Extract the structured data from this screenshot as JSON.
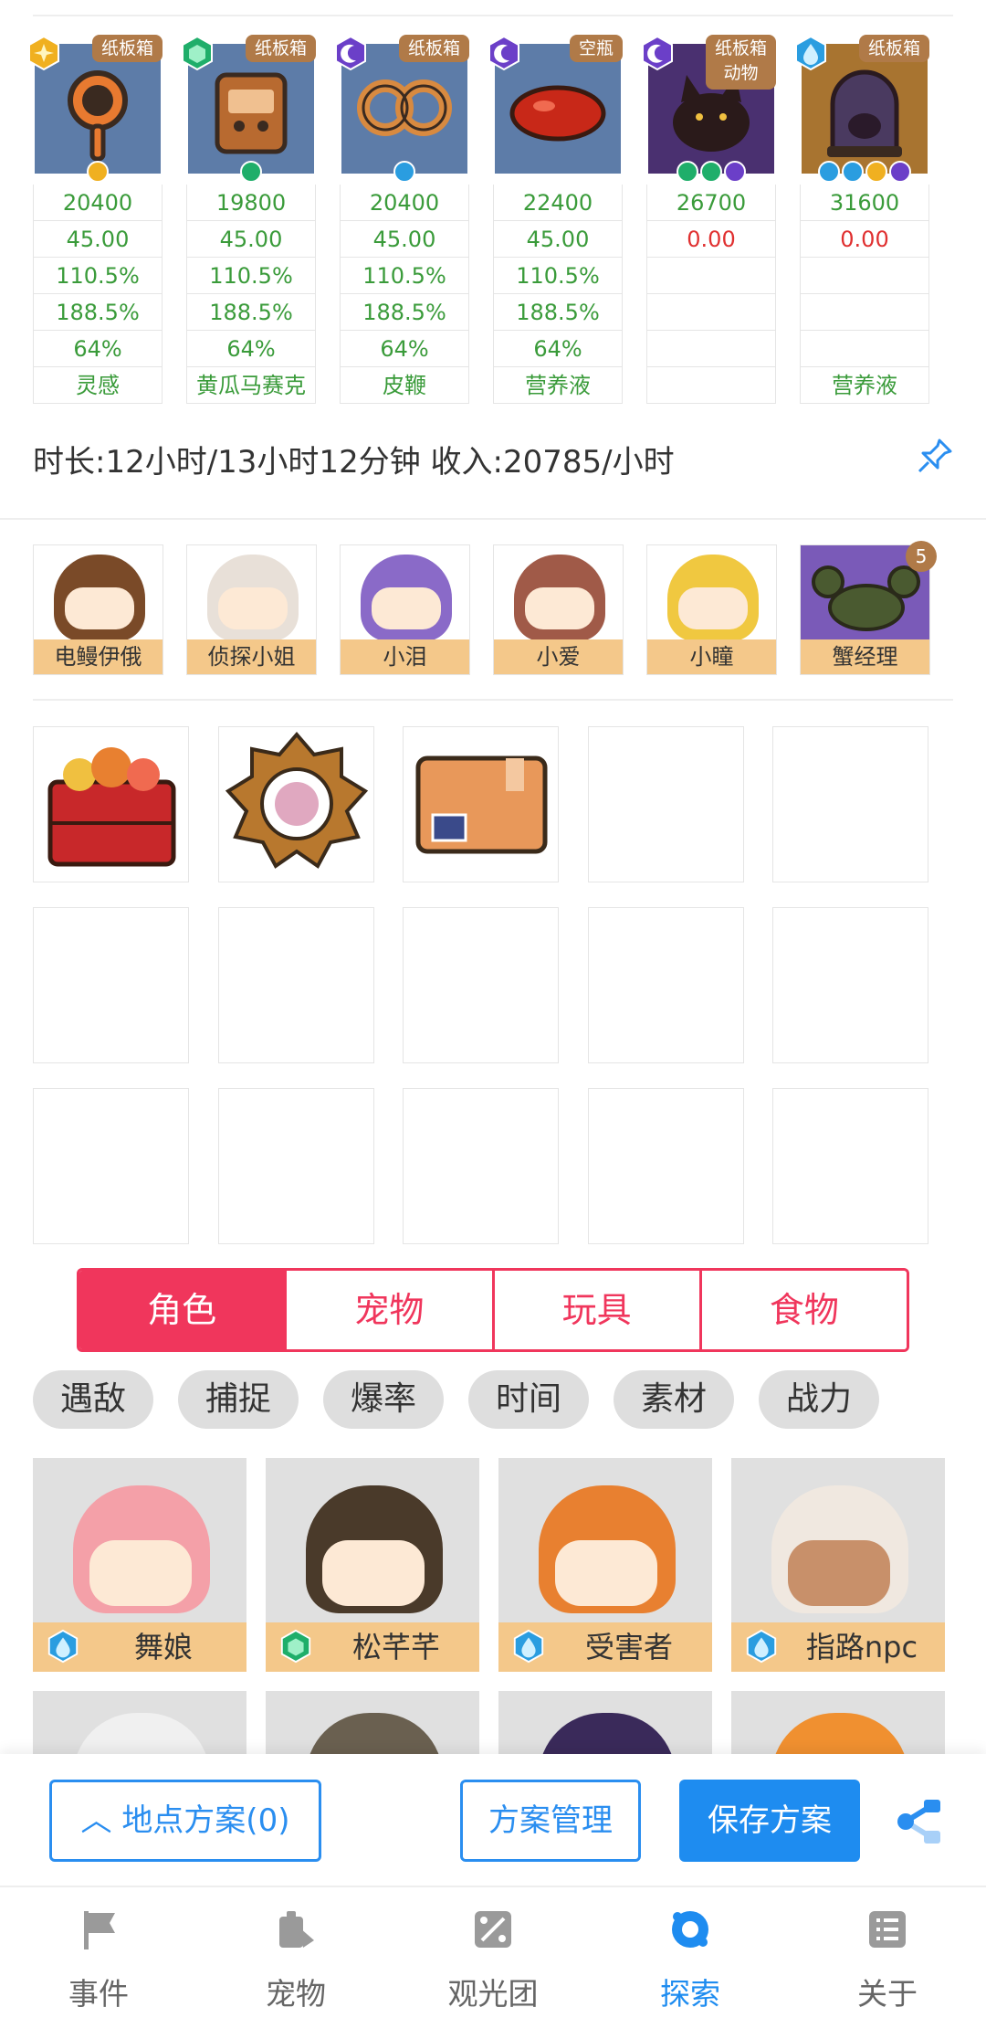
{
  "locations": [
    {
      "tag": "纸板箱",
      "income": "20400",
      "v1": "45.00",
      "v2": "110.5%",
      "v3": "188.5%",
      "v4": "64%",
      "bonus": "灵感",
      "badge_color": "#f0b020",
      "img": "magnifier"
    },
    {
      "tag": "纸板箱",
      "income": "19800",
      "v1": "45.00",
      "v2": "110.5%",
      "v3": "188.5%",
      "v4": "64%",
      "bonus": "黄瓜马赛克",
      "badge_color": "#1fae6a",
      "img": "box"
    },
    {
      "tag": "纸板箱",
      "income": "20400",
      "v1": "45.00",
      "v2": "110.5%",
      "v3": "188.5%",
      "v4": "64%",
      "bonus": "皮鞭",
      "badge_color": "#6b3fc8",
      "img": "whip"
    },
    {
      "tag": "空瓶",
      "income": "22400",
      "v1": "45.00",
      "v2": "110.5%",
      "v3": "188.5%",
      "v4": "64%",
      "bonus": "营养液",
      "badge_color": "#6b3fc8",
      "img": "blob"
    },
    {
      "tag": "纸板箱",
      "tag2": "动物",
      "income": "26700",
      "v1": "0.00",
      "v2": "",
      "v3": "",
      "v4": "",
      "bonus": "",
      "badge_color": "#6b3fc8",
      "img": "cat"
    },
    {
      "tag": "纸板箱",
      "income": "31600",
      "v1": "0.00",
      "v2": "",
      "v3": "",
      "v4": "",
      "bonus": "营养液",
      "badge_color": "#2a9de0",
      "img": "jar"
    }
  ],
  "duration_text": "时长:12小时/13小时12分钟 收入:20785/小时",
  "team": [
    {
      "name": "电鳗伊俄",
      "hair": "#7a4a28"
    },
    {
      "name": "侦探小姐",
      "hair": "#e8e0d8"
    },
    {
      "name": "小泪",
      "hair": "#8a6ac8"
    },
    {
      "name": "小爱",
      "hair": "#a05a48"
    },
    {
      "name": "小瞳",
      "hair": "#f0c840"
    },
    {
      "name": "蟹经理",
      "hair": "#7a5ab8"
    }
  ],
  "team_badge": "5",
  "tabs": [
    "角色",
    "宠物",
    "玩具",
    "食物"
  ],
  "filters": [
    "遇敌",
    "捕捉",
    "爆率",
    "时间",
    "素材",
    "战力"
  ],
  "characters": [
    {
      "name": "舞娘",
      "gem": "#2a9de0",
      "hair": "#f4a0a8"
    },
    {
      "name": "松芊芊",
      "gem": "#1fae6a",
      "hair": "#4a3a2a"
    },
    {
      "name": "受害者",
      "gem": "#2a9de0",
      "hair": "#e88030"
    },
    {
      "name": "指路npc",
      "gem": "#2a9de0",
      "hair": "#f0e8e0"
    }
  ],
  "buttons": {
    "plan_location": "地点方案(0)",
    "plan_manage": "方案管理",
    "plan_save": "保存方案"
  },
  "nav": [
    {
      "label": "事件"
    },
    {
      "label": "宠物"
    },
    {
      "label": "观光团"
    },
    {
      "label": "探索"
    },
    {
      "label": "关于"
    }
  ]
}
